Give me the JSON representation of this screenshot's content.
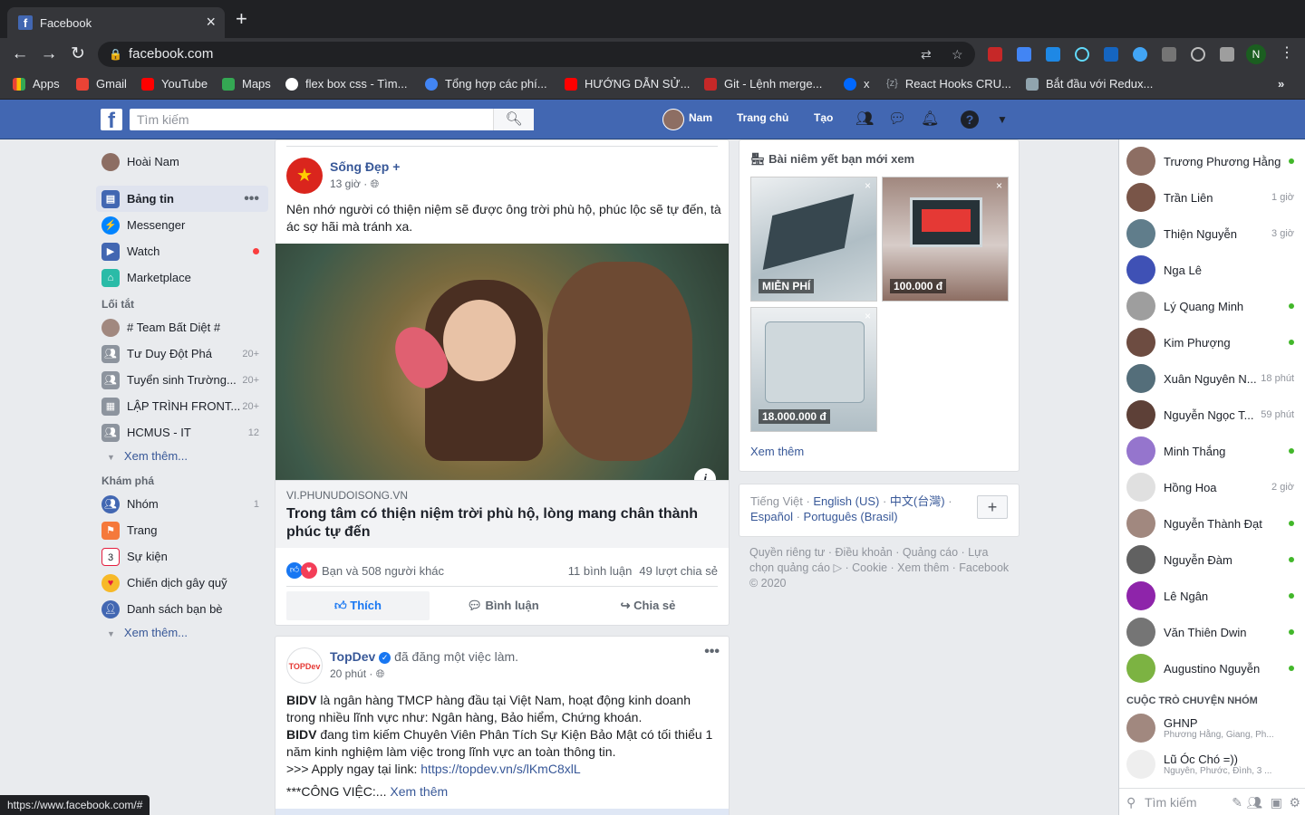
{
  "browser": {
    "tab_title": "Facebook",
    "url": "facebook.com",
    "status_url": "https://www.facebook.com/#",
    "bookmarks": [
      "Apps",
      "Gmail",
      "YouTube",
      "Maps",
      "flex box css - Tìm...",
      "Tổng hợp các phí...",
      "HƯỚNG DẪN SỬ...",
      "Git - Lệnh merge...",
      "x",
      "React Hooks CRU...",
      "Bắt đầu với Redux..."
    ],
    "profile_initial": "N",
    "more": "»"
  },
  "header": {
    "search_placeholder": "Tìm kiếm",
    "user": "Nam",
    "nav": [
      "Trang chủ",
      "Tạo"
    ]
  },
  "left_nav": {
    "profile": "Hoài Nam",
    "main": [
      {
        "label": "Bảng tin",
        "active": true
      },
      {
        "label": "Messenger"
      },
      {
        "label": "Watch",
        "dot": true
      },
      {
        "label": "Marketplace"
      }
    ],
    "shortcuts_title": "Lối tắt",
    "shortcuts": [
      {
        "label": "# Team Bất Diệt #",
        "count": ""
      },
      {
        "label": "Tư Duy Đột Phá",
        "count": "20+"
      },
      {
        "label": "Tuyển sinh Trường...",
        "count": "20+"
      },
      {
        "label": "LẬP TRÌNH FRONT...",
        "count": "20+"
      },
      {
        "label": "HCMUS - IT",
        "count": "12"
      }
    ],
    "see_more": "Xem thêm...",
    "explore_title": "Khám phá",
    "explore": [
      {
        "label": "Nhóm",
        "count": "1"
      },
      {
        "label": "Trang",
        "count": ""
      },
      {
        "label": "Sự kiện",
        "count": ""
      },
      {
        "label": "Chiến dịch gây quỹ",
        "count": ""
      },
      {
        "label": "Danh sách bạn bè",
        "count": ""
      }
    ]
  },
  "post1": {
    "author": "Sống Đẹp +",
    "time": "13 giờ ·",
    "text": "Nên nhớ người có thiện niệm sẽ được ông trời phù hộ, phúc lộc sẽ tự đến, tà ác sợ hãi mà tránh xa.",
    "link_domain": "VI.PHUNUDOISONG.VN",
    "link_title": "Trong tâm có thiện niệm trời phù hộ, lòng mang chân thành phúc tự đến",
    "reactions": "Bạn và 508 người khác",
    "comments": "11 bình luận",
    "shares": "49 lượt chia sẻ",
    "actions": [
      "Thích",
      "Bình luận",
      "Chia sẻ"
    ]
  },
  "post2": {
    "author": "TopDev",
    "action": "đã đăng một việc làm.",
    "time": "20 phút ·",
    "line1_bold": "BIDV",
    "line1": " là ngân hàng TMCP hàng đầu tại Việt Nam, hoạt động kinh doanh trong nhiều lĩnh vực như: Ngân hàng, Bảo hiểm, Chứng khoán.",
    "line2_bold": "BIDV",
    "line2": " đang tìm kiếm Chuyên Viên Phân Tích Sự Kiện Bảo Mật có tối thiểu 1 năm kinh nghiệm làm việc trong lĩnh vực an toàn thông tin.",
    "line3": ">>> Apply ngay tại link: ",
    "link": "https://topdev.vn/s/lKmC8xlL",
    "line4": "***CÔNG VIỆC:... ",
    "see_more": "Xem thêm",
    "logo_text": "TOPDev"
  },
  "marketplace": {
    "title": "Bài niêm yết bạn mới xem",
    "items": [
      {
        "price": "MIỄN PHÍ"
      },
      {
        "price": "100.000 đ"
      },
      {
        "price": "18.000.000 đ"
      }
    ],
    "see_more": "Xem thêm"
  },
  "languages": {
    "current": "Tiếng Việt",
    "others": [
      "English (US)",
      "中文(台灣)",
      "Español",
      "Português (Brasil)"
    ]
  },
  "footer": "Quyền riêng tư · Điều khoản · Quảng cáo · Lựa chọn quảng cáo ▷ · Cookie · Xem thêm · Facebook © 2020",
  "chat": {
    "contacts": [
      {
        "name": "Trương Phương Hằng",
        "time": "",
        "online": true
      },
      {
        "name": "Trần Liên",
        "time": "1 giờ",
        "online": false
      },
      {
        "name": "Thiện Nguyễn",
        "time": "3 giờ",
        "online": false
      },
      {
        "name": "Nga Lê",
        "time": "",
        "online": false
      },
      {
        "name": "Lý Quang Minh",
        "time": "",
        "online": true
      },
      {
        "name": "Kim Phượng",
        "time": "",
        "online": true
      },
      {
        "name": "Xuân Nguyên N...",
        "time": "18 phút",
        "online": false
      },
      {
        "name": "Nguyễn Ngọc T...",
        "time": "59 phút",
        "online": false
      },
      {
        "name": "Minh Thắng",
        "time": "",
        "online": true
      },
      {
        "name": "Hồng Hoa",
        "time": "2 giờ",
        "online": false
      },
      {
        "name": "Nguyễn Thành Đạt",
        "time": "",
        "online": true
      },
      {
        "name": "Nguyễn Đàm",
        "time": "",
        "online": true
      },
      {
        "name": "Lê Ngân",
        "time": "",
        "online": true
      },
      {
        "name": "Văn Thiên Dwin",
        "time": "",
        "online": true
      },
      {
        "name": "Augustino Nguyễn",
        "time": "",
        "online": true
      }
    ],
    "groups_title": "CUỘC TRÒ CHUYỆN NHÓM",
    "groups": [
      {
        "name": "GHNP",
        "members": "Phương Hằng, Giang, Ph..."
      },
      {
        "name": "Lũ Óc Chó =))",
        "members": "Nguyên, Phước, Đình, 3 ..."
      }
    ],
    "search": "Tìm kiếm"
  }
}
